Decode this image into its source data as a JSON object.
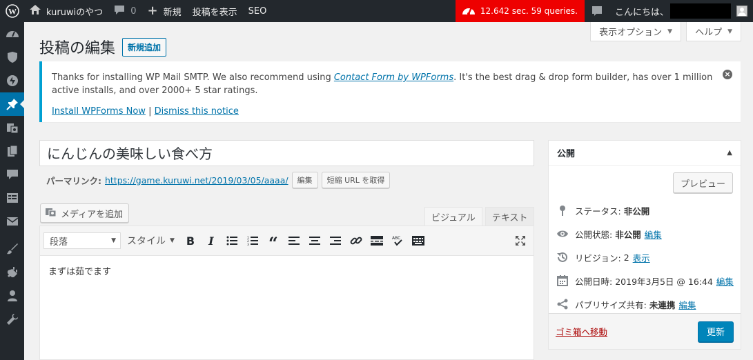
{
  "adminbar": {
    "site_name": "kuruwiのやつ",
    "comments_count": "0",
    "new_label": "新規",
    "view_post_label": "投稿を表示",
    "seo_label": "SEO",
    "perf_label": "12.642 sec. 59 queries.",
    "greeting": "こんにちは、",
    "perf_color": "#ee0000"
  },
  "screen_meta": {
    "screen_options": "表示オプション",
    "help": "ヘルプ"
  },
  "header": {
    "title": "投稿の編集",
    "add_new": "新規追加"
  },
  "notice": {
    "text_before": "Thanks for installing WP Mail SMTP. We also recommend using ",
    "link_text": "Contact Form by WPForms",
    "text_after": ". It's the best drag & drop form builder, has over 1 million active installs, and over 2000+ 5 star ratings.",
    "install_link": "Install WPForms Now",
    "separator": "|",
    "dismiss_link": "Dismiss this notice"
  },
  "post": {
    "title": "にんじんの美味しい食べ方",
    "permalink_label": "パーマリンク:",
    "permalink_url": "https://game.kuruwi.net/2019/03/05/aaaa/",
    "edit_button": "編集",
    "shortlink_button": "短縮 URL を取得"
  },
  "editor": {
    "add_media": "メディアを追加",
    "tab_visual": "ビジュアル",
    "tab_text": "テキスト",
    "format_select": "段落",
    "styles_label": "スタイル",
    "content": "まずは茹でます"
  },
  "publish": {
    "title": "公開",
    "preview": "プレビュー",
    "status_label": "ステータス:",
    "status_value": "非公開",
    "visibility_label": "公開状態:",
    "visibility_value": "非公開",
    "visibility_edit": "編集",
    "revisions_label": "リビジョン:",
    "revisions_value": "2",
    "revisions_link": "表示",
    "date_label": "公開日時:",
    "date_value": "2019年3月5日 @ 16:44",
    "date_edit": "編集",
    "publicize_label": "パブリサイズ共有:",
    "publicize_value": "未連携",
    "publicize_edit": "編集",
    "trash": "ゴミ箱へ移動",
    "update": "更新"
  },
  "colors": {
    "accent": "#0073aa",
    "admin_bar": "#23282d",
    "primary_button": "#0085ba"
  }
}
